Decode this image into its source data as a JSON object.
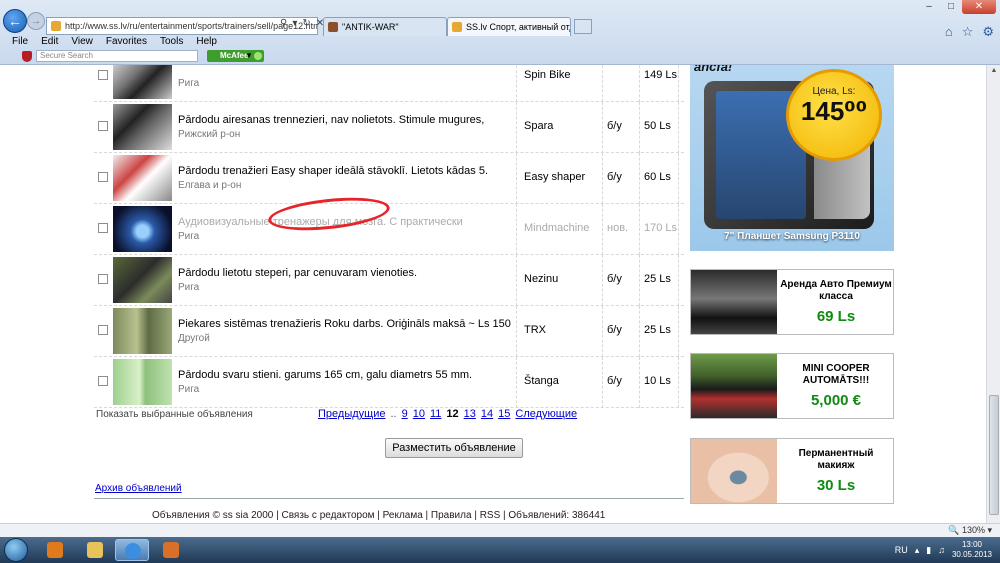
{
  "browser": {
    "url": "http://www.ss.lv/ru/entertainment/sports/trainers/sell/page12.html",
    "tabs": [
      {
        "label": "\"ANTIK-WAR\""
      },
      {
        "label": "SS.lv Спорт, активный отд..."
      }
    ],
    "menu": [
      "File",
      "Edit",
      "View",
      "Favorites",
      "Tools",
      "Help"
    ],
    "secure_search_placeholder": "Secure Search",
    "mcafee_label": "McAfee",
    "zoom": "130%"
  },
  "listings": [
    {
      "title": "",
      "location": "Рига",
      "model": "Spin Bike",
      "condition": "",
      "price": "149 Ls",
      "faded": false,
      "thumb": "spin-bike"
    },
    {
      "title": "Pārdodu airesanas trennezieri, nav nolietots. Stimule mugures,",
      "location": "Рижский р-он",
      "model": "Spara",
      "condition": "б/у",
      "price": "50 Ls",
      "faded": false,
      "thumb": "rower"
    },
    {
      "title": "Pārdodu trenažieri Easy shaper ideālā stāvoklī. Lietots kādas 5.",
      "location": "Елгава и р-он",
      "model": "Easy shaper",
      "condition": "б/у",
      "price": "60 Ls",
      "faded": false,
      "thumb": "shaper"
    },
    {
      "title": "Аудиовизуальные тренажеры для мозга. С практически",
      "location": "Рига",
      "model": "Mindmachine",
      "condition": "нов.",
      "price": "170 Ls",
      "faded": true,
      "thumb": "mind"
    },
    {
      "title": "Pārdodu lietotu steperi, par cenuvaram vienoties.",
      "location": "Рига",
      "model": "Nezinu",
      "condition": "б/у",
      "price": "25 Ls",
      "faded": false,
      "thumb": "stepper"
    },
    {
      "title": "Piekares sistēmas trenažieris Roku darbs. Oriģināls maksā ~ Ls 150",
      "location": "Другой",
      "model": "TRX",
      "condition": "б/у",
      "price": "25 Ls",
      "faded": false,
      "thumb": "trx"
    },
    {
      "title": "Pārdodu svaru stieni. garums 165 cm, galu diametrs 55 mm.",
      "location": "Рига",
      "model": "Štanga",
      "condition": "б/у",
      "price": "10 Ls",
      "faded": false,
      "thumb": "barbell"
    }
  ],
  "pager": {
    "show_selected": "Показать выбранные объявления",
    "prev": "Предыдущие",
    "dots": "..",
    "pages": [
      "9",
      "10",
      "11",
      "12",
      "13",
      "14",
      "15"
    ],
    "current": "12",
    "next": "Следующие"
  },
  "post_button": "Разместить объявление",
  "archive_link": "Архив объявлений",
  "footer": "Объявления © ss sia 2000  |  Связь с редактором | Реклама | Правила | RSS | Объявлений: 386441",
  "ads": {
    "tablet": {
      "logo": "ancfa!",
      "price_label": "Цена, Ls:",
      "price": "145⁰⁰",
      "caption": "7\" Планшет Samsung P3110"
    },
    "car": {
      "title": "Аренда Авто Премиум класса",
      "price": "69 Ls"
    },
    "mini": {
      "title": "MINI COOPER AUTOMĀTS!!!",
      "price": "5,000 €"
    },
    "makeup": {
      "title": "Перманентный макияж",
      "price": "30 Ls"
    }
  },
  "taskbar": {
    "lang": "RU",
    "time": "13:00",
    "date": "30.05.2013"
  }
}
